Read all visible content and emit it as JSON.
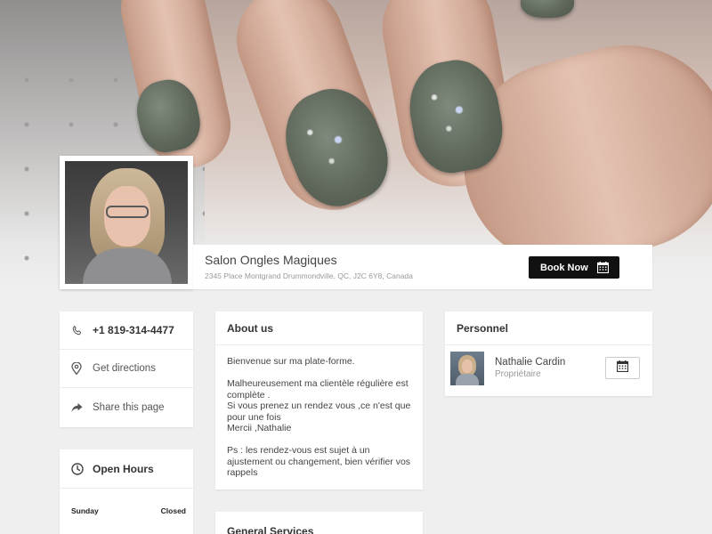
{
  "salon": {
    "name": "Salon Ongles Magiques",
    "address": "2345 Place Montgrand Drummondville, QC, J2C 6Y8, Canada"
  },
  "header": {
    "book_label": "Book Now"
  },
  "contact": {
    "phone": "+1 819-314-4477",
    "directions_label": "Get directions",
    "share_label": "Share this page"
  },
  "hours": {
    "title": "Open Hours",
    "rows": [
      {
        "day": "Sunday",
        "value": "Closed"
      }
    ]
  },
  "about": {
    "title": "About us",
    "text": "Bienvenue  sur ma plate-forme.\n\nMalheureusement ma clientèle régulière est complète .\nSi vous prenez un rendez vous ,ce n'est que pour une fois\nMercii ,Nathalie\n\nPs : les rendez-vous est sujet à un ajustement ou changement, bien vérifier vos rappels"
  },
  "services": {
    "title": "General Services"
  },
  "personnel": {
    "title": "Personnel",
    "staff": [
      {
        "name": "Nathalie Cardin",
        "role": "Propriétaire"
      }
    ]
  },
  "icons": {
    "phone": "phone-icon",
    "directions": "map-pin-icon",
    "share": "share-arrow-icon",
    "clock": "clock-icon",
    "calendar": "calendar-icon"
  }
}
